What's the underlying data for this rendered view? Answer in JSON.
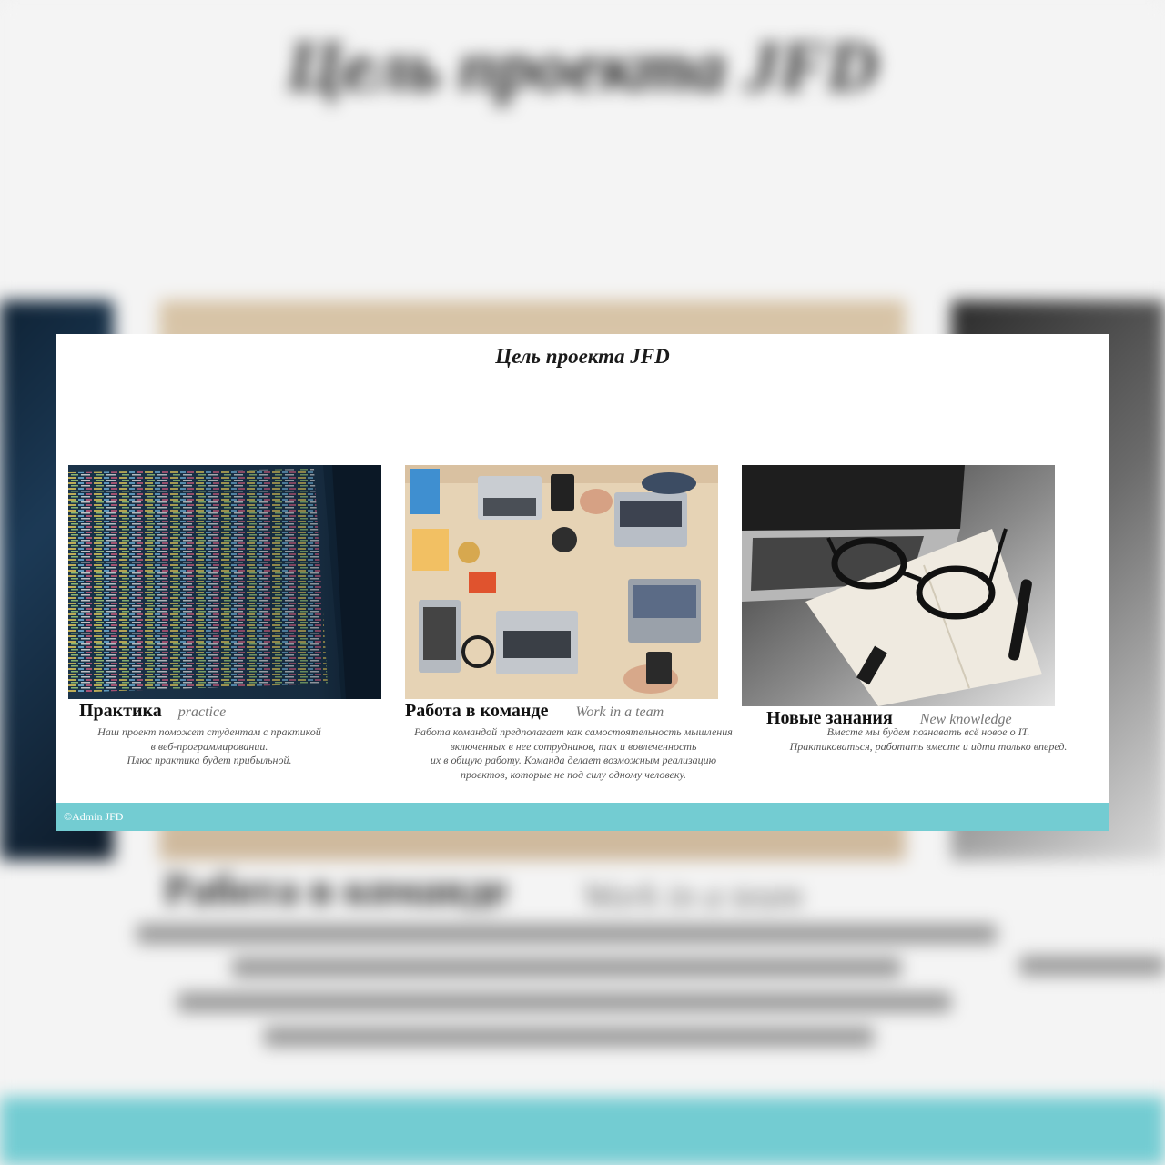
{
  "page": {
    "title": "Цель проекта JFD"
  },
  "cards": [
    {
      "heading": "Практика",
      "subheading": "practice",
      "lines": [
        "Наш проект поможет студентам с практикой",
        "в веб-программировании.",
        "Плюс практика будет прибыльной."
      ],
      "image": "code-on-monitor"
    },
    {
      "heading": "Работа в команде",
      "subheading": "Work in a team",
      "lines": [
        "Работа командой предполагает как самостоятельность мышления",
        "включенных в нее сотрудников, так и вовлеченность",
        "их в общую работу. Команда делает возможным реализацию",
        "проектов, которые не под силу одному человеку."
      ],
      "image": "team-at-desk-with-laptops"
    },
    {
      "heading": "Новые занания",
      "subheading": "New knowledge",
      "lines": [
        "Вместе мы будем познавать всё новое о IT.",
        "Практиковаться, работать вместе и идти только вперед."
      ],
      "image": "laptop-notebook-glasses"
    }
  ],
  "footer": {
    "copyright": "©Admin JFD"
  },
  "colors": {
    "footer": "#73ccd2",
    "page_background": "#ffffff"
  }
}
